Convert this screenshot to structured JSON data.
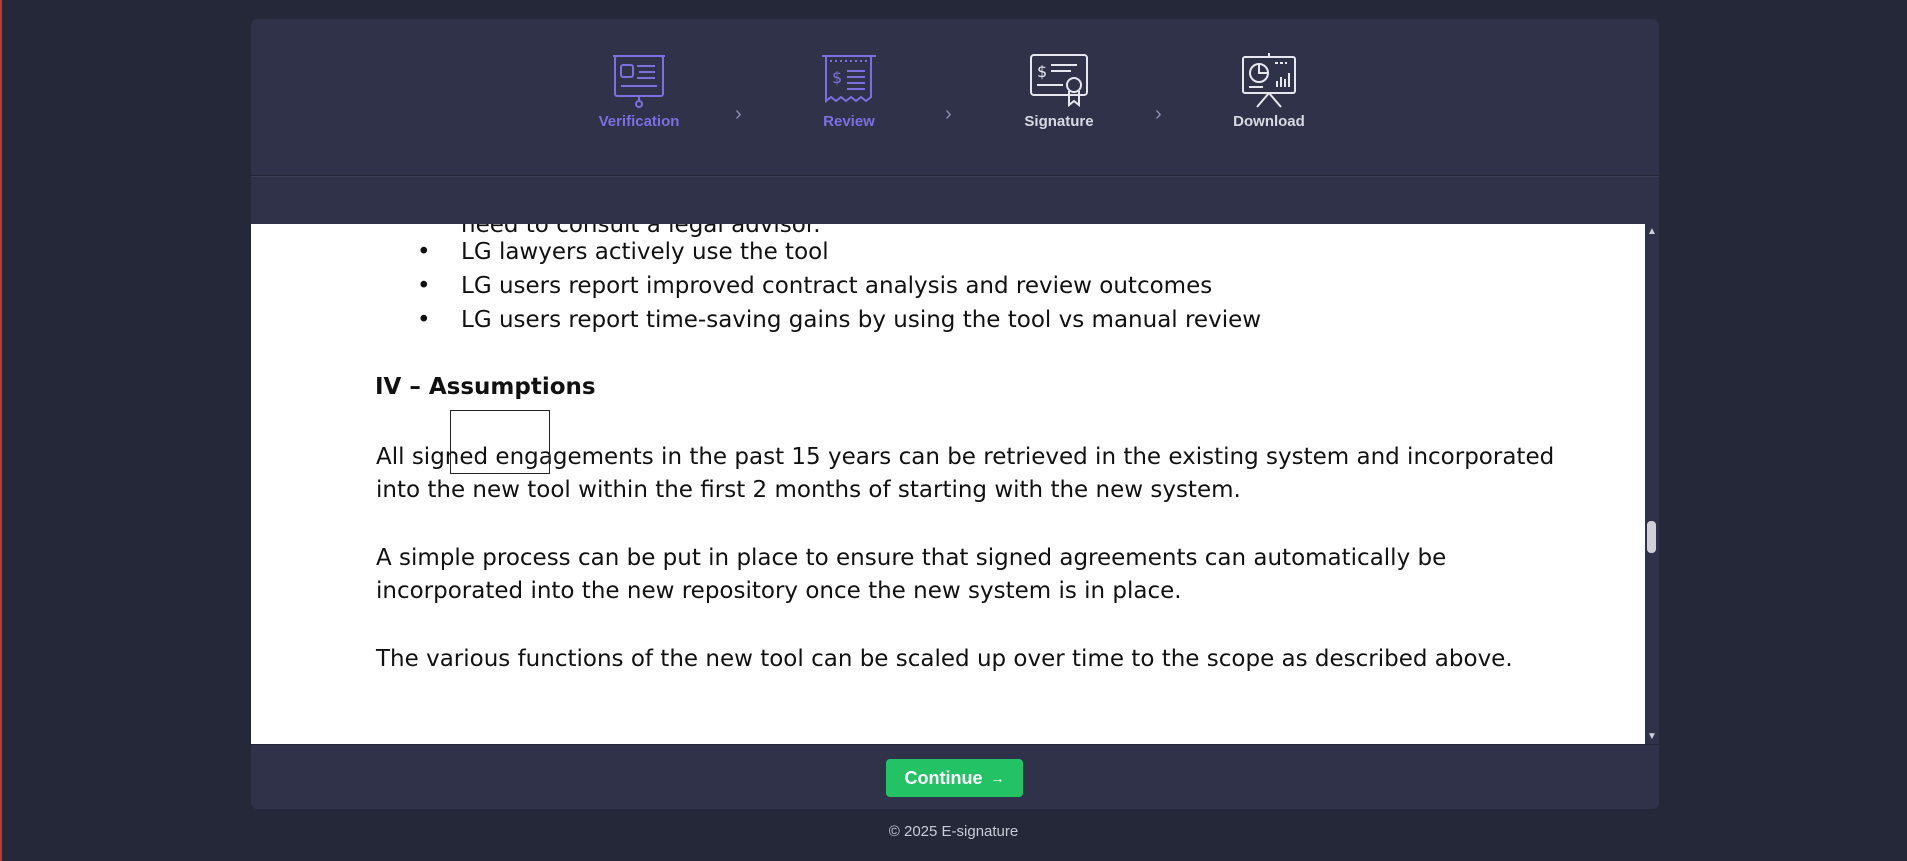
{
  "stepper": {
    "steps": [
      {
        "label": "Verification",
        "icon": "presentation-board-icon",
        "state": "active"
      },
      {
        "label": "Review",
        "icon": "dollar-receipt-icon",
        "state": "active"
      },
      {
        "label": "Signature",
        "icon": "certificate-icon",
        "state": "inactive"
      },
      {
        "label": "Download",
        "icon": "chart-easel-icon",
        "state": "inactive"
      }
    ],
    "separator": "›"
  },
  "document": {
    "partial_line": "need to consult a legal advisor.",
    "bullets": [
      "LG lawyers actively use the tool",
      "LG users report improved contract analysis and review outcomes",
      "LG users report time-saving gains by using the tool vs manual review"
    ],
    "bullet_symbol": "•",
    "heading": "IV – Assumptions",
    "paragraphs": [
      [
        "All signed engagements in the past 15 years can be retrieved in the existing system and incorporated",
        "into the new tool within the first 2 months of starting with the new system."
      ],
      [
        "A simple process can be put in place to ensure that signed agreements can automatically be",
        "incorporated into the new repository once the new system is in place."
      ],
      [
        "The various functions of the new tool can be scaled up over time to the scope as described above."
      ]
    ]
  },
  "footer": {
    "continue_label": "Continue",
    "continue_arrow": "→",
    "copyright": "© 2025 E-signature"
  },
  "colors": {
    "active_step": "#7c6fe0",
    "inactive_step": "#d8d9e4",
    "continue_button": "#23c265",
    "panel": "#2f3248",
    "background": "#252839"
  }
}
